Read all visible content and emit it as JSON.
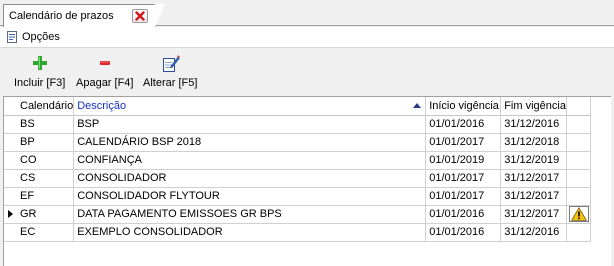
{
  "tab": {
    "label": "Calendário de prazos"
  },
  "menu": {
    "opcoes_label": "Opções"
  },
  "toolbar": {
    "incluir_label": "Incluir [F3]",
    "apagar_label": "Apagar [F4]",
    "alterar_label": "Alterar [F5]"
  },
  "colors": {
    "sorted_header": "#1733c4",
    "add_icon": "#2fa52f",
    "remove_icon": "#e0242a",
    "close_icon": "#d4181f",
    "warning_icon": "#f2c21b"
  },
  "grid": {
    "columns": {
      "calendario": "Calendário",
      "descricao": "Descrição",
      "inicio": "Início vigência",
      "fim": "Fim vigência"
    },
    "sort": {
      "column": "Descrição",
      "direction": "ascending"
    },
    "current_row": 5,
    "rows": [
      {
        "code": "BS",
        "desc": "BSP",
        "start": "01/01/2016",
        "end": "31/12/2016",
        "warning": false
      },
      {
        "code": "BP",
        "desc": "CALENDÁRIO BSP 2018",
        "start": "01/01/2017",
        "end": "31/12/2018",
        "warning": false
      },
      {
        "code": "CO",
        "desc": "CONFIANÇA",
        "start": "01/01/2019",
        "end": "31/12/2019",
        "warning": false
      },
      {
        "code": "CS",
        "desc": "CONSOLIDADOR",
        "start": "01/01/2017",
        "end": "31/12/2017",
        "warning": false
      },
      {
        "code": "EF",
        "desc": "CONSOLIDADOR FLYTOUR",
        "start": "01/01/2017",
        "end": "31/12/2017",
        "warning": false
      },
      {
        "code": "GR",
        "desc": "DATA PAGAMENTO EMISSOES GR BPS",
        "start": "01/01/2016",
        "end": "31/12/2017",
        "warning": true
      },
      {
        "code": "EC",
        "desc": "EXEMPLO CONSOLIDADOR",
        "start": "01/01/2016",
        "end": "31/12/2016",
        "warning": false
      }
    ]
  }
}
